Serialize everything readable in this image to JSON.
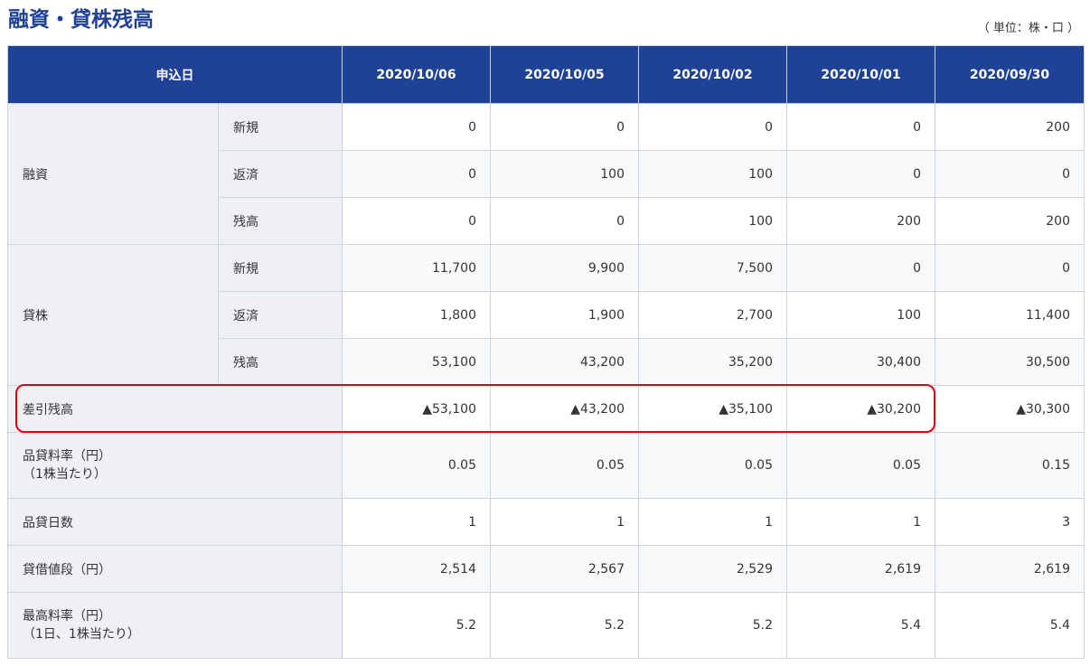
{
  "page": {
    "title": "融資・貸株残高",
    "unit_note": "（ 単位：株・口 ）"
  },
  "table": {
    "header_label": "申込日",
    "dates": [
      "2020/10/06",
      "2020/10/05",
      "2020/10/02",
      "2020/10/01",
      "2020/09/30"
    ],
    "groups": {
      "loan": {
        "label": "融資",
        "rows": [
          {
            "label": "新規",
            "values": [
              "0",
              "0",
              "0",
              "0",
              "200"
            ]
          },
          {
            "label": "返済",
            "values": [
              "0",
              "100",
              "100",
              "0",
              "0"
            ]
          },
          {
            "label": "残高",
            "values": [
              "0",
              "0",
              "100",
              "200",
              "200"
            ]
          }
        ]
      },
      "stock_lending": {
        "label": "貸株",
        "rows": [
          {
            "label": "新規",
            "values": [
              "11,700",
              "9,900",
              "7,500",
              "0",
              "0"
            ]
          },
          {
            "label": "返済",
            "values": [
              "1,800",
              "1,900",
              "2,700",
              "100",
              "11,400"
            ]
          },
          {
            "label": "残高",
            "values": [
              "53,100",
              "43,200",
              "35,200",
              "30,400",
              "30,500"
            ]
          }
        ]
      }
    },
    "net_balance": {
      "label": "差引残高",
      "values": [
        "▲53,100",
        "▲43,200",
        "▲35,100",
        "▲30,200",
        "▲30,300"
      ]
    },
    "fee_rate": {
      "label_line1": "品貸料率（円）",
      "label_line2": "（1株当たり）",
      "values": [
        "0.05",
        "0.05",
        "0.05",
        "0.05",
        "0.15"
      ]
    },
    "fee_days": {
      "label": "品貸日数",
      "values": [
        "1",
        "1",
        "1",
        "1",
        "3"
      ]
    },
    "lending_price": {
      "label": "貸借値段（円）",
      "values": [
        "2,514",
        "2,567",
        "2,529",
        "2,619",
        "2,619"
      ]
    },
    "max_rate": {
      "label_line1": "最高料率（円）",
      "label_line2": "（1日、1株当たり）",
      "values": [
        "5.2",
        "5.2",
        "5.2",
        "5.4",
        "5.4"
      ]
    }
  },
  "colors": {
    "header_bg": "#1f4296",
    "title_color": "#1f4296",
    "label_bg": "#eef0f6",
    "highlight_border": "#e60012"
  }
}
